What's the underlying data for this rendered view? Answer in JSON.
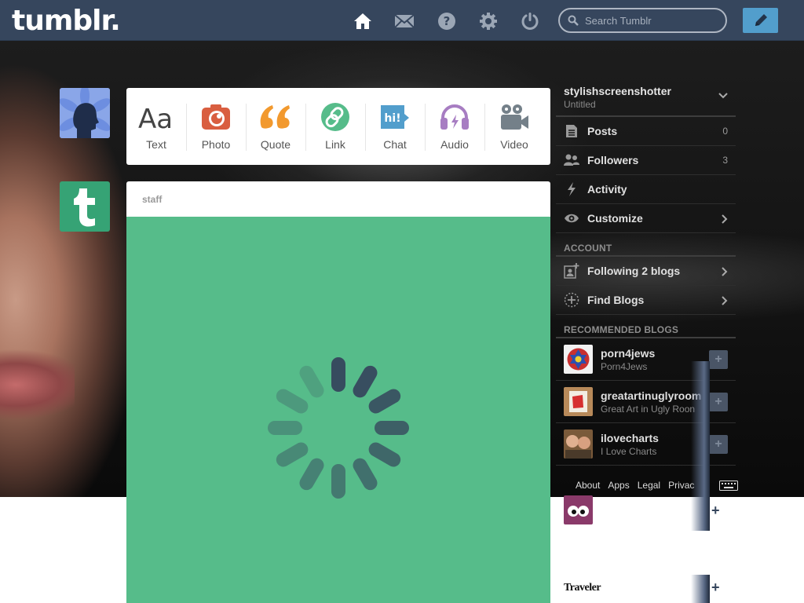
{
  "header": {
    "logo": "tumblr.",
    "search_placeholder": "Search Tumblr"
  },
  "post_types": [
    {
      "label": "Text",
      "icon": "text-icon",
      "color": "#444444"
    },
    {
      "label": "Photo",
      "icon": "photo-icon",
      "color": "#d95e40"
    },
    {
      "label": "Quote",
      "icon": "quote-icon",
      "color": "#f2992e"
    },
    {
      "label": "Link",
      "icon": "link-icon",
      "color": "#56bc8a"
    },
    {
      "label": "Chat",
      "icon": "chat-icon",
      "color": "#529ecc"
    },
    {
      "label": "Audio",
      "icon": "audio-icon",
      "color": "#a77dc2"
    },
    {
      "label": "Video",
      "icon": "video-icon",
      "color": "#748089"
    }
  ],
  "post": {
    "blog": "staff",
    "background": "#56bc8a"
  },
  "sidebar": {
    "blog_name": "stylishscreenshotter",
    "blog_title": "Untitled",
    "rows": [
      {
        "label": "Posts",
        "count": "0"
      },
      {
        "label": "Followers",
        "count": "3"
      },
      {
        "label": "Activity"
      },
      {
        "label": "Customize"
      }
    ],
    "account_heading": "ACCOUNT",
    "account_rows": [
      {
        "label": "Following 2 blogs"
      },
      {
        "label": "Find Blogs"
      }
    ],
    "recommended_heading": "RECOMMENDED BLOGS",
    "recommended": [
      {
        "name": "porn4jews",
        "title": "Porn4Jews"
      },
      {
        "name": "greatartinuglyroom",
        "title": "Great Art in Ugly Roon"
      },
      {
        "name": "ilovecharts",
        "title": "I Love Charts"
      }
    ],
    "footer": {
      "about": "About",
      "apps": "Apps",
      "legal": "Legal",
      "privacy": "Privac"
    }
  },
  "extra_thumb_text": "Traveler",
  "plus_symbol": "+"
}
